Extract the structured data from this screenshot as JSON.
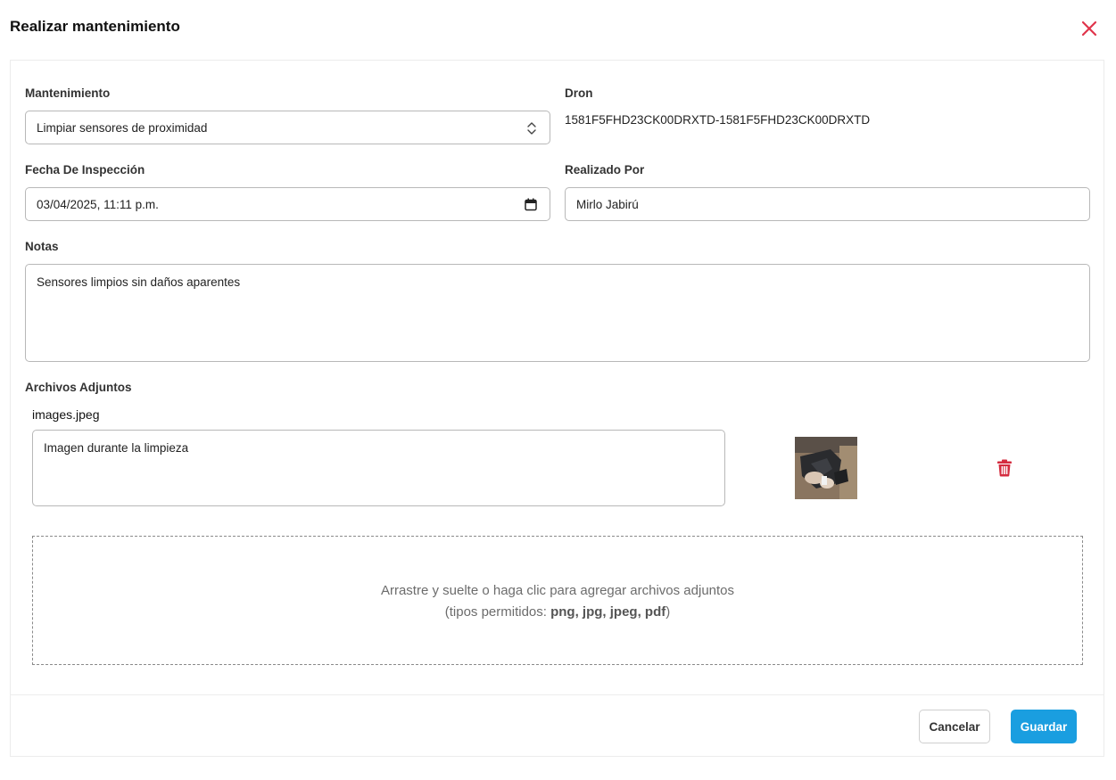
{
  "header": {
    "title": "Realizar mantenimiento",
    "close_icon": "close-icon",
    "close_color": "#e0344a"
  },
  "form": {
    "maintenance": {
      "label": "Mantenimiento",
      "value": "Limpiar sensores de proximidad"
    },
    "drone": {
      "label": "Dron",
      "value": "1581F5FHD23CK00DRXTD-1581F5FHD23CK00DRXTD"
    },
    "inspection_date": {
      "label": "Fecha De Inspección",
      "value": "03/04/2025, 11:11 p.m."
    },
    "performed_by": {
      "label": "Realizado Por",
      "value": "Mirlo Jabirú"
    },
    "notes": {
      "label": "Notas",
      "value": "Sensores limpios sin daños aparentes"
    }
  },
  "attachments": {
    "label": "Archivos Adjuntos",
    "items": [
      {
        "filename": "images.jpeg",
        "description": "Imagen durante la limpieza",
        "delete_icon": "trash-icon"
      }
    ],
    "dropzone": {
      "line1": "Arrastre y suelte o haga clic para agregar archivos adjuntos",
      "line2_prefix": "(tipos permitidos: ",
      "types": "png, jpg, jpeg, pdf",
      "line2_suffix": ")"
    }
  },
  "footer": {
    "cancel_label": "Cancelar",
    "save_label": "Guardar",
    "accent_color": "#1a9ee0"
  }
}
